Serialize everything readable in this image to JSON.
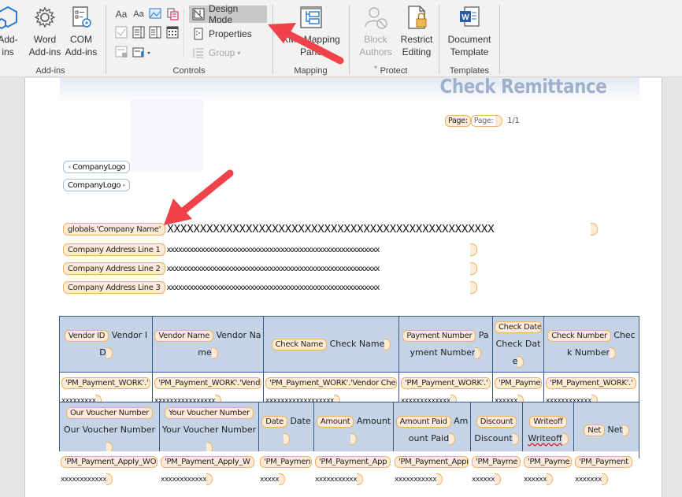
{
  "ribbon": {
    "groups": {
      "addins": {
        "label": "Add-ins",
        "buttons": [
          {
            "label_line1": "Add-",
            "label_line2": "ins",
            "icon": "hexagon-addins-icon"
          },
          {
            "label_line1": "Word",
            "label_line2": "Add-ins",
            "icon": "gear-icon"
          },
          {
            "label_line1": "COM",
            "label_line2": "Add-ins",
            "icon": "com-addins-icon"
          }
        ]
      },
      "controls": {
        "label": "Controls",
        "design_mode": "Design Mode",
        "properties": "Properties",
        "group": "Group",
        "icons": [
          "rich-text-control-icon",
          "plain-text-control-icon",
          "picture-control-icon",
          "building-block-control-icon",
          "checkbox-control-icon",
          "combo-box-control-icon",
          "dropdown-list-control-icon",
          "date-picker-control-icon",
          "repeating-section-control-icon",
          "legacy-tools-icon"
        ]
      },
      "mapping": {
        "label": "Mapping",
        "button_line1": "XML Mapping",
        "button_line2": "Pane"
      },
      "protect": {
        "label": "Protect",
        "block_line1": "Block",
        "block_line2": "Authors",
        "restrict_line1": "Restrict",
        "restrict_line2": "Editing"
      },
      "templates": {
        "label": "Templates",
        "doc_line1": "Document",
        "doc_line2": "Template"
      }
    }
  },
  "document": {
    "title": "Check Remittance",
    "page_label_cc": "Page:",
    "page_label_value": "Page:",
    "page_number": "1/1",
    "company_logo_1": "CompanyLogo",
    "company_logo_2": "CompanyLogo",
    "company_name_tag": "globals.'Company Name'",
    "company_name_value": "XXXXXXXXXXXXXXXXXXXXXXXXXXXXXXXXXXXXXXXXXXXXXXXXXX",
    "address_lines": [
      {
        "tag": "Company Address Line 1",
        "value": "xxxxxxxxxxxxxxxxxxxxxxxxxxxxxxxxxxxxxxxxxxxxxxxxxxxxxxxx"
      },
      {
        "tag": "Company Address Line 2",
        "value": "xxxxxxxxxxxxxxxxxxxxxxxxxxxxxxxxxxxxxxxxxxxxxxxxxxxxxxxx"
      },
      {
        "tag": "Company Address Line 3",
        "value": "xxxxxxxxxxxxxxxxxxxxxxxxxxxxxxxxxxxxxxxxxxxxxxxxxxxxxxxx"
      }
    ],
    "payment_table": {
      "headers": [
        {
          "tag": "Vendor ID",
          "text": "Vendor ID"
        },
        {
          "tag": "Vendor Name",
          "text": "Vendor Name"
        },
        {
          "tag": "Check Name",
          "text": "Check Name"
        },
        {
          "tag": "Payment Number",
          "text": "Payment Number"
        },
        {
          "tag": "Check Date",
          "text": "Check Date"
        },
        {
          "tag": "Check Number",
          "text": "Check Number"
        }
      ],
      "values": [
        {
          "tag": "'PM_Payment_WORK'.'",
          "value": "xxxxxxxxx"
        },
        {
          "tag": "'PM_Payment_WORK'.'Vend",
          "value": "xxxxxxxxxxxxxxxx"
        },
        {
          "tag": "'PM_Payment_WORK'.'Vendor Che",
          "value": "xxxxxxxxxxxxxxxxxx"
        },
        {
          "tag": "'PM_Payment_WORK'.'",
          "value": "xxxxxxxxxxxxx"
        },
        {
          "tag": "'PM_Payme",
          "value": "xxxxxx"
        },
        {
          "tag": "'PM_Payment_WORK'.'",
          "value": "xxxxxxxxxxxx"
        }
      ]
    },
    "apply_table": {
      "headers": [
        {
          "tag": "Our Voucher Number",
          "text": "Our Voucher Number"
        },
        {
          "tag": "Your Voucher Number",
          "text": "Your Voucher Number"
        },
        {
          "tag": "Date",
          "text": "Date"
        },
        {
          "tag": "Amount",
          "text": "Amount"
        },
        {
          "tag": "Amount Paid",
          "text": "Amount Paid"
        },
        {
          "tag": "Discount",
          "text": "Discount"
        },
        {
          "tag": "Writeoff",
          "text": "Writeoff"
        },
        {
          "tag": "Net",
          "text": "Net"
        }
      ],
      "values": [
        {
          "tag": "'PM_Payment_Apply_WO",
          "value": "xxxxxxxxxxxx"
        },
        {
          "tag": "'PM_Payment_Apply_W",
          "value": "xxxxxxxxxxxx"
        },
        {
          "tag": "'PM_Paymen",
          "value": "xxxxx"
        },
        {
          "tag": "'PM_Payment_App",
          "value": "xxxxxxxxxxx"
        },
        {
          "tag": "'PM_Payment_Apply",
          "value": "xxxxxxxxxxx"
        },
        {
          "tag": "'PM_Payme",
          "value": "xxxxxx"
        },
        {
          "tag": "'PM_Payme",
          "value": "xxxxxx"
        },
        {
          "tag": "'PM_Payment",
          "value": "xxxxxxx"
        }
      ]
    }
  },
  "colors": {
    "annotation_arrow": "#f0424a",
    "title": "#9fb0cc",
    "table_header_bg": "#c5d3e7",
    "table_border": "#3a5a8c",
    "content_control_bg": "#fdebd7",
    "content_control_border": "#f2b15a"
  }
}
